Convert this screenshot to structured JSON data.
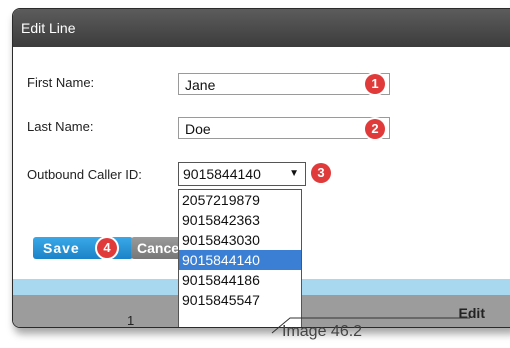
{
  "dialog": {
    "title": "Edit Line",
    "fields": {
      "first_name": {
        "label": "First Name:",
        "value": "Jane",
        "badge": "1"
      },
      "last_name": {
        "label": "Last Name:",
        "value": "Doe",
        "badge": "2"
      },
      "caller_id": {
        "label": "Outbound Caller ID:",
        "selected": "9015844140",
        "arrow": "▼",
        "badge": "3",
        "options": [
          "2057219879",
          "9015842363",
          "9015843030",
          "9015844140",
          "9015844186",
          "9015845547"
        ]
      }
    },
    "buttons": {
      "save": "Save",
      "save_badge": "4",
      "cancel": "Cancel"
    },
    "table": {
      "edit_header": "Edit",
      "partial_cell": "1"
    }
  },
  "caption": "Image 46.2",
  "colors": {
    "titlebar": "#3c3c3c",
    "badge": "#e03a3a",
    "save": "#1b82c8",
    "selected_option": "#3a7fd4",
    "blue_row": "#a8d8ef",
    "gray_header": "#9c9c9c"
  }
}
